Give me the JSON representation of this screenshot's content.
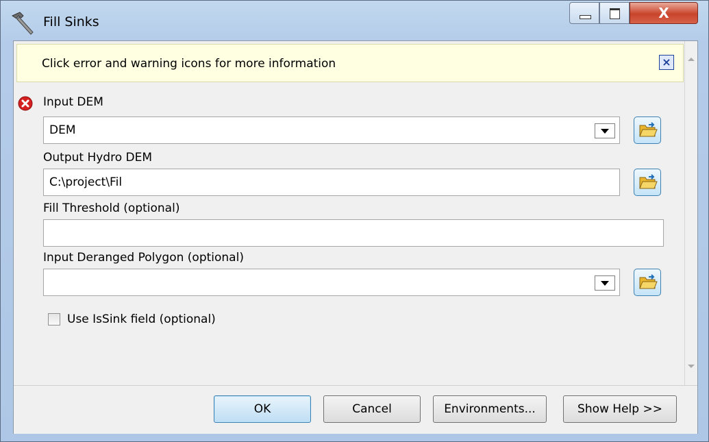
{
  "window": {
    "title": "Fill Sinks"
  },
  "message_bar": {
    "text": "Click error and warning icons for more information",
    "close_glyph": "×"
  },
  "params": {
    "input_dem": {
      "label": "Input DEM",
      "value": "DEM"
    },
    "output_dem": {
      "label": "Output Hydro DEM",
      "value": "C:\\project\\Fil"
    },
    "fill_threshold": {
      "label": "Fill Threshold (optional)",
      "value": ""
    },
    "deranged_polygon": {
      "label": "Input Deranged Polygon (optional)",
      "value": ""
    },
    "use_issink": {
      "label": "Use IsSink field (optional)",
      "checked": false
    }
  },
  "buttons": {
    "ok": "OK",
    "cancel": "Cancel",
    "environments": "Environments...",
    "help": "Show Help >>"
  },
  "titlebar_buttons": {
    "close_glyph": "X"
  },
  "icons": [
    "hammer-icon",
    "error-icon",
    "folder-open-icon",
    "dropdown-arrow-icon"
  ],
  "colors": {
    "message_bg": "#ffffe1",
    "error_red": "#d42020",
    "title_bar": "#b9d1ea",
    "client_bg": "#f0f0f0"
  }
}
